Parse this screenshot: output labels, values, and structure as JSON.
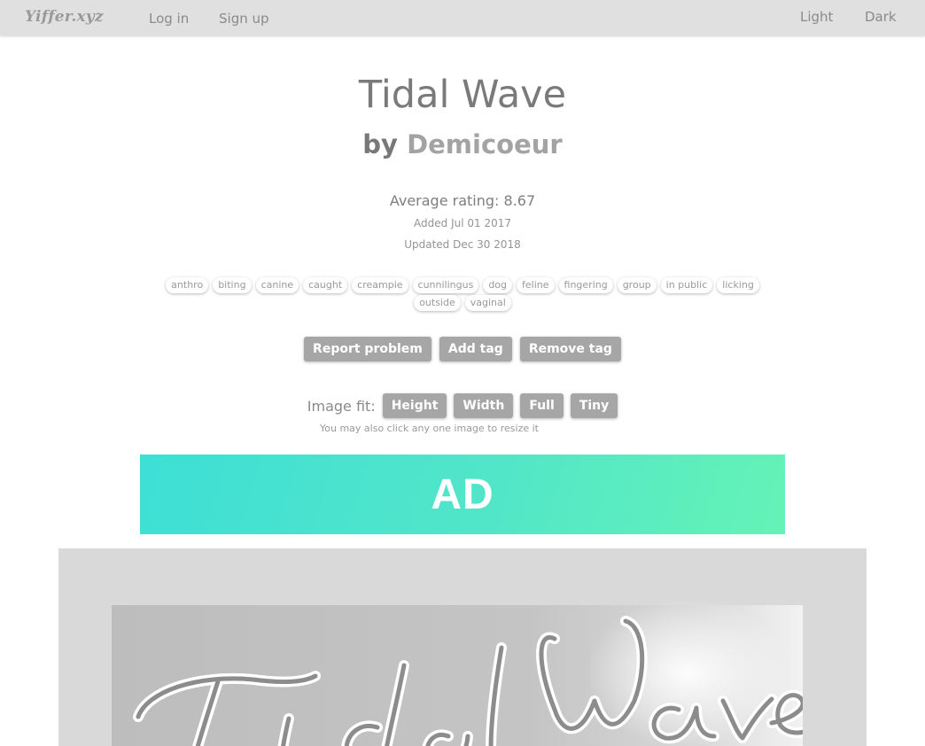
{
  "nav": {
    "logo": "Yiffer.xyz",
    "login": "Log in",
    "signup": "Sign up",
    "light": "Light",
    "dark": "Dark"
  },
  "comic": {
    "title": "Tidal Wave",
    "by_label": "by",
    "artist": "Demicoeur",
    "rating": "Average rating: 8.67",
    "added": "Added Jul 01 2017",
    "updated": "Updated Dec 30 2018"
  },
  "tags": [
    "anthro",
    "biting",
    "canine",
    "caught",
    "creampie",
    "cunnilingus",
    "dog",
    "feline",
    "fingering",
    "group",
    "in public",
    "licking",
    "outside",
    "vaginal"
  ],
  "actions": {
    "report": "Report problem",
    "add_tag": "Add tag",
    "remove_tag": "Remove tag"
  },
  "image_fit": {
    "label": "Image fit:",
    "options": [
      "Height",
      "Width",
      "Full",
      "Tiny"
    ],
    "hint": "You may also click any one image to resize it"
  },
  "ad": {
    "text": "AD",
    "colors": [
      "#3edfd6",
      "#64f3b6"
    ]
  },
  "cover": {
    "lettering": "Tidal Wave"
  }
}
